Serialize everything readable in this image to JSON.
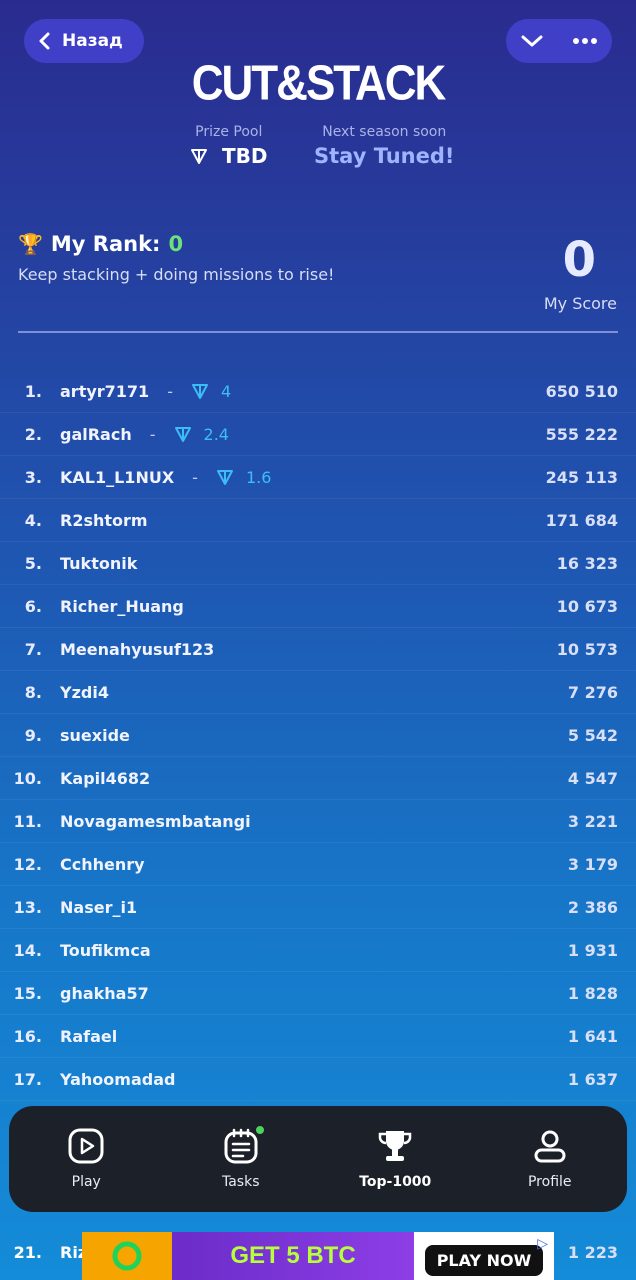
{
  "header": {
    "back_label": "Назад",
    "title": "CUT&STACK",
    "prize_pool_label": "Prize Pool",
    "prize_pool_value": "TBD",
    "next_season_label": "Next season soon",
    "next_season_value": "Stay Tuned!"
  },
  "my_rank": {
    "label": "My Rank:",
    "value": "0",
    "hint": "Keep stacking + doing missions to rise!",
    "score_value": "0",
    "score_label": "My Score"
  },
  "leaderboard": [
    {
      "rank": "1.",
      "name": "artyr7171",
      "dash": "-",
      "prize": "4",
      "score": "650 510"
    },
    {
      "rank": "2.",
      "name": "galRach",
      "dash": "-",
      "prize": "2.4",
      "score": "555 222"
    },
    {
      "rank": "3.",
      "name": "KAL1_L1NUX",
      "dash": "-",
      "prize": "1.6",
      "score": "245 113"
    },
    {
      "rank": "4.",
      "name": "R2shtorm",
      "score": "171 684"
    },
    {
      "rank": "5.",
      "name": "Tuktonik",
      "score": "16 323"
    },
    {
      "rank": "6.",
      "name": "Richer_Huang",
      "score": "10 673"
    },
    {
      "rank": "7.",
      "name": "Meenahyusuf123",
      "score": "10 573"
    },
    {
      "rank": "8.",
      "name": "Yzdi4",
      "score": "7 276"
    },
    {
      "rank": "9.",
      "name": "suexide",
      "score": "5 542"
    },
    {
      "rank": "10.",
      "name": "Kapil4682",
      "score": "4 547"
    },
    {
      "rank": "11.",
      "name": "Novagamesmbatangi",
      "score": "3 221"
    },
    {
      "rank": "12.",
      "name": "Cchhenry",
      "score": "3 179"
    },
    {
      "rank": "13.",
      "name": "Naser_i1",
      "score": "2 386"
    },
    {
      "rank": "14.",
      "name": "Toufikmca",
      "score": "1 931"
    },
    {
      "rank": "15.",
      "name": "ghakha57",
      "score": "1 828"
    },
    {
      "rank": "16.",
      "name": "Rafael",
      "score": "1 641"
    },
    {
      "rank": "17.",
      "name": "Yahoomadad",
      "score": "1 637"
    }
  ],
  "row21": {
    "rank": "21.",
    "name": "Riz",
    "score": "1 223"
  },
  "nav": [
    {
      "label": "Play",
      "icon": "play-icon"
    },
    {
      "label": "Tasks",
      "icon": "tasks-icon"
    },
    {
      "label": "Top-1000",
      "icon": "trophy-icon",
      "active": true
    },
    {
      "label": "Profile",
      "icon": "profile-icon"
    }
  ],
  "ad": {
    "text": "GET 5 BTC",
    "cta": "PLAY NOW"
  },
  "colors": {
    "accent_green": "#6ee07a",
    "ton_blue": "#3dbdf5",
    "navbar_bg": "#1c2028"
  }
}
